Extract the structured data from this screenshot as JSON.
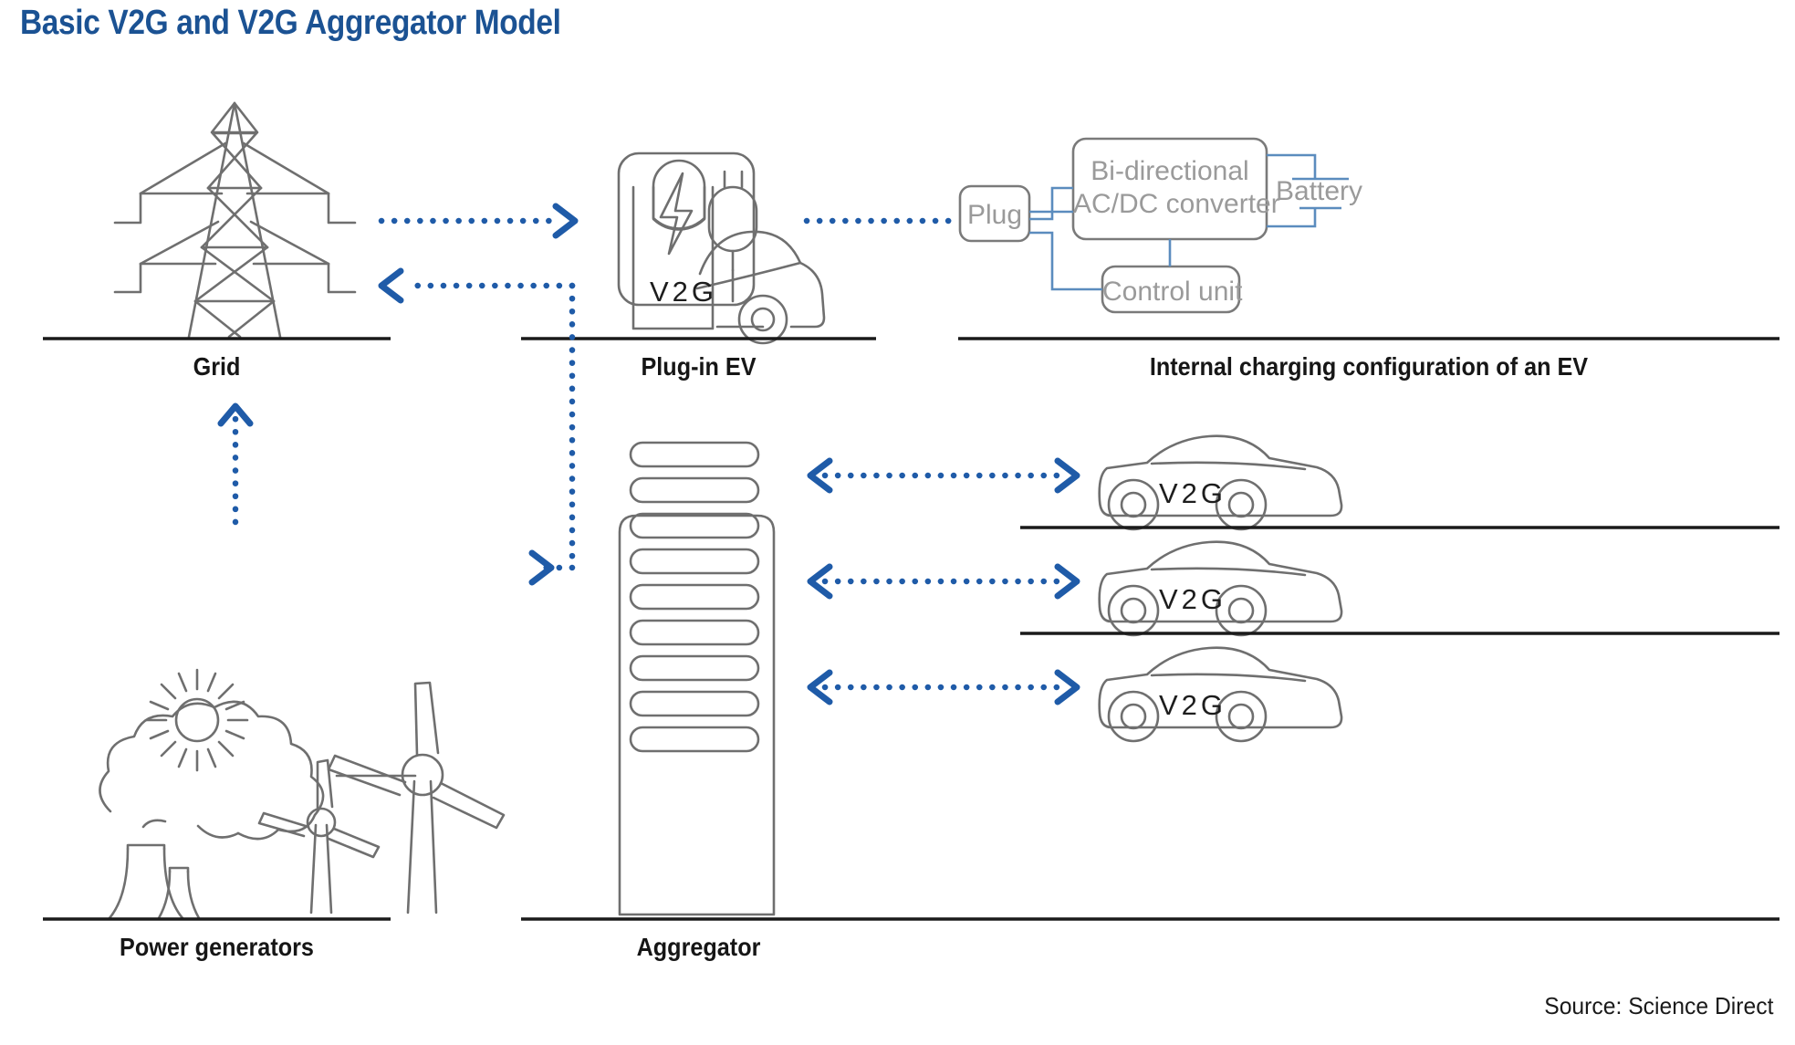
{
  "title": "Basic V2G and V2G Aggregator Model",
  "source": "Source: Science Direct",
  "colors": {
    "title_blue": "#1b5293",
    "arrow_blue": "#1f5ba8",
    "line_gray": "#6f6f6f",
    "box_text_gray": "#9a9a9a",
    "connector_blue": "#5b8cbe",
    "ground_black": "#1a1a1a",
    "background": "#ffffff"
  },
  "sections": {
    "grid": {
      "caption": "Grid"
    },
    "plug_in_ev": {
      "caption": "Plug-in EV",
      "station_label": "V2G"
    },
    "internal_config": {
      "caption": "Internal charging configuration of an EV",
      "blocks": {
        "plug": "Plug",
        "converter_line1": "Bi-directional",
        "converter_line2": "AC/DC converter",
        "battery": "Battery",
        "control_unit": "Control unit"
      }
    },
    "power_generators": {
      "caption": "Power generators"
    },
    "aggregator": {
      "caption": "Aggregator"
    },
    "fleet": {
      "cars": [
        {
          "label": "V2G"
        },
        {
          "label": "V2G"
        },
        {
          "label": "V2G"
        }
      ]
    }
  },
  "flows": [
    {
      "name": "grid-to-ev",
      "from": "Grid",
      "to": "Plug-in EV",
      "direction": "one-way"
    },
    {
      "name": "ev-to-internal-config",
      "from": "Plug-in EV",
      "to": "Internal charging configuration of an EV",
      "direction": "none"
    },
    {
      "name": "generators-to-grid",
      "from": "Power generators",
      "to": "Grid",
      "direction": "one-way"
    },
    {
      "name": "aggregator-to-grid",
      "from": "Aggregator",
      "to": "Grid",
      "direction": "one-way"
    },
    {
      "name": "grid-bus-to-aggregator",
      "from": "Grid bus",
      "to": "Aggregator",
      "direction": "one-way"
    },
    {
      "name": "aggregator-to-car-1",
      "from": "Aggregator",
      "to": "V2G car 1",
      "direction": "two-way"
    },
    {
      "name": "aggregator-to-car-2",
      "from": "Aggregator",
      "to": "V2G car 2",
      "direction": "two-way"
    },
    {
      "name": "aggregator-to-car-3",
      "from": "Aggregator",
      "to": "V2G car 3",
      "direction": "two-way"
    }
  ]
}
